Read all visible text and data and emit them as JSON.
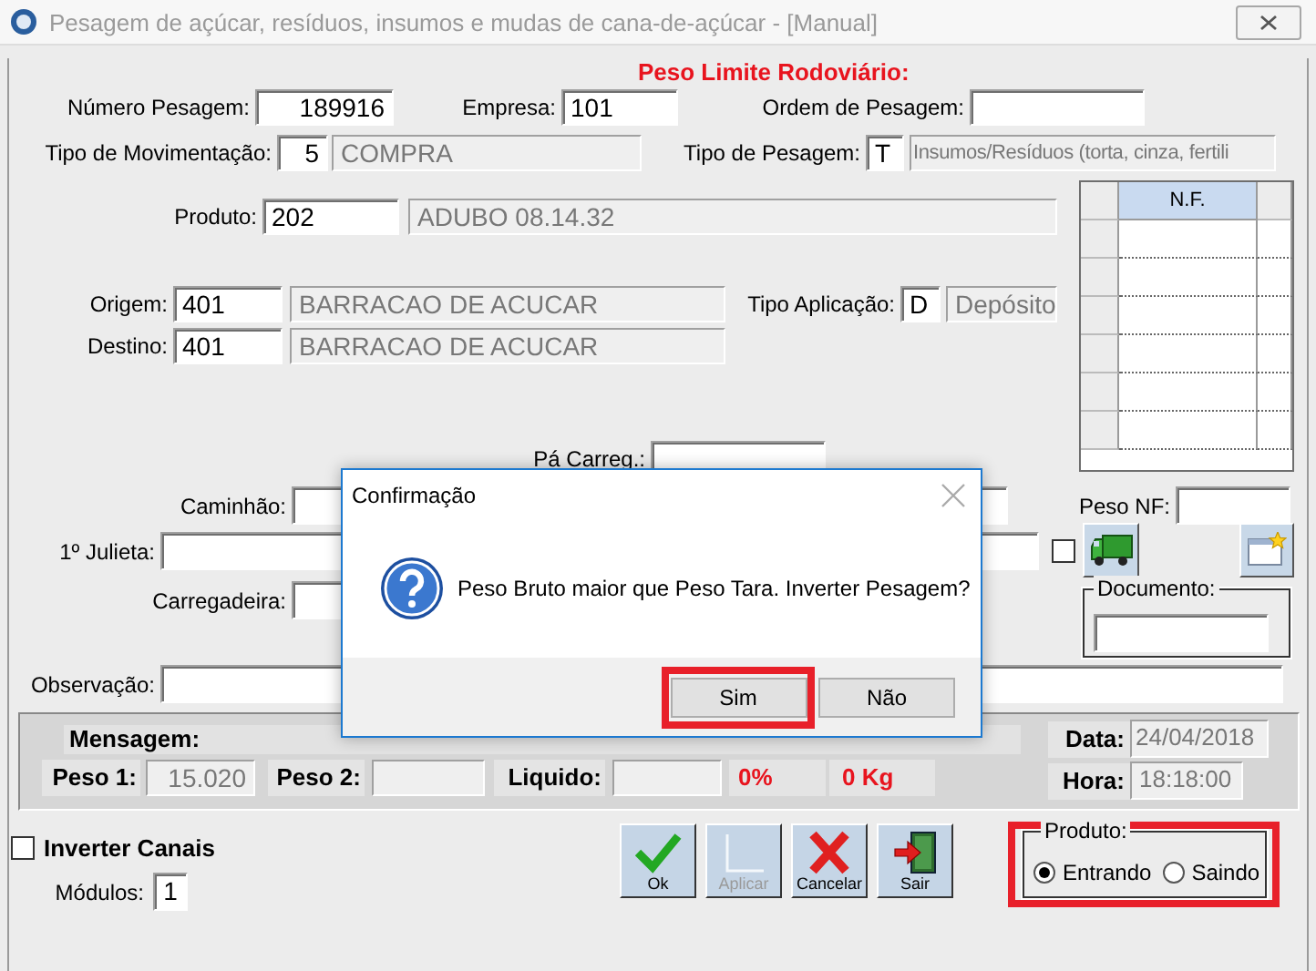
{
  "window": {
    "title": "Pesagem de açúcar, resíduos, insumos e mudas de cana-de-açúcar - [Manual]"
  },
  "limit_title": "Peso Limite Rodoviário:",
  "header": {
    "numero_pesagem": {
      "label": "Número Pesagem:",
      "value": "189916"
    },
    "empresa": {
      "label": "Empresa:",
      "value": "101"
    },
    "ordem_pesagem": {
      "label": "Ordem de Pesagem:"
    },
    "tipo_movimentacao": {
      "label": "Tipo de Movimentação:",
      "code": "5",
      "description": "COMPRA"
    },
    "tipo_pesagem": {
      "label": "Tipo de Pesagem:",
      "code": "T",
      "description": "Insumos/Resíduos (torta, cinza, fertili"
    },
    "produto": {
      "label": "Produto:",
      "code": "202",
      "description": "ADUBO 08.14.32"
    },
    "origem": {
      "label": "Origem:",
      "code": "401",
      "description": "BARRACAO DE ACUCAR"
    },
    "destino": {
      "label": "Destino:",
      "code": "401",
      "description": "BARRACAO DE ACUCAR"
    },
    "tipo_aplicacao": {
      "label": "Tipo Aplicação:",
      "code": "D",
      "description": "Depósito"
    },
    "pa_carreg": {
      "label": "Pá Carreg.:"
    },
    "caminhao": {
      "label": "Caminhão:"
    },
    "julieta": {
      "label": "1º Julieta:"
    },
    "carregadeira": {
      "label": "Carregadeira:"
    },
    "peso_nf": {
      "label": "Peso NF:"
    },
    "documento": {
      "label": "Documento:"
    },
    "observacao": {
      "label": "Observação:"
    }
  },
  "extra_check": {
    "checked": false
  },
  "nf_table": {
    "columns": [
      "N.F."
    ]
  },
  "summary": {
    "mensagem_label": "Mensagem:",
    "peso1": {
      "label": "Peso 1:",
      "value": "15.020"
    },
    "peso2": {
      "label": "Peso 2:"
    },
    "liquido": {
      "label": "Liquido:"
    },
    "percent": "0%",
    "kg": "0 Kg",
    "data": {
      "label": "Data:",
      "value": "24/04/2018"
    },
    "hora": {
      "label": "Hora:",
      "value": "18:18:00"
    }
  },
  "inverter_canais": {
    "label": "Inverter Canais",
    "checked": false
  },
  "modulos": {
    "label": "Módulos:",
    "value": "1"
  },
  "buttons": [
    {
      "label": "Ok",
      "kind": "ok",
      "disabled": false
    },
    {
      "label": "Aplicar",
      "kind": "apply",
      "disabled": true
    },
    {
      "label": "Cancelar",
      "kind": "cancel",
      "disabled": false
    },
    {
      "label": "Sair",
      "kind": "exit",
      "disabled": false
    }
  ],
  "produto_group": {
    "title": "Produto:",
    "highlighted": true,
    "options": [
      {
        "label": "Entrando",
        "selected": true
      },
      {
        "label": "Saindo",
        "selected": false
      }
    ]
  },
  "dialog": {
    "title": "Confirmação",
    "message": "Peso Bruto maior que Peso Tara. Inverter Pesagem?",
    "buttons": [
      {
        "label": "Sim",
        "highlighted": true
      },
      {
        "label": "Não",
        "highlighted": false
      }
    ]
  }
}
